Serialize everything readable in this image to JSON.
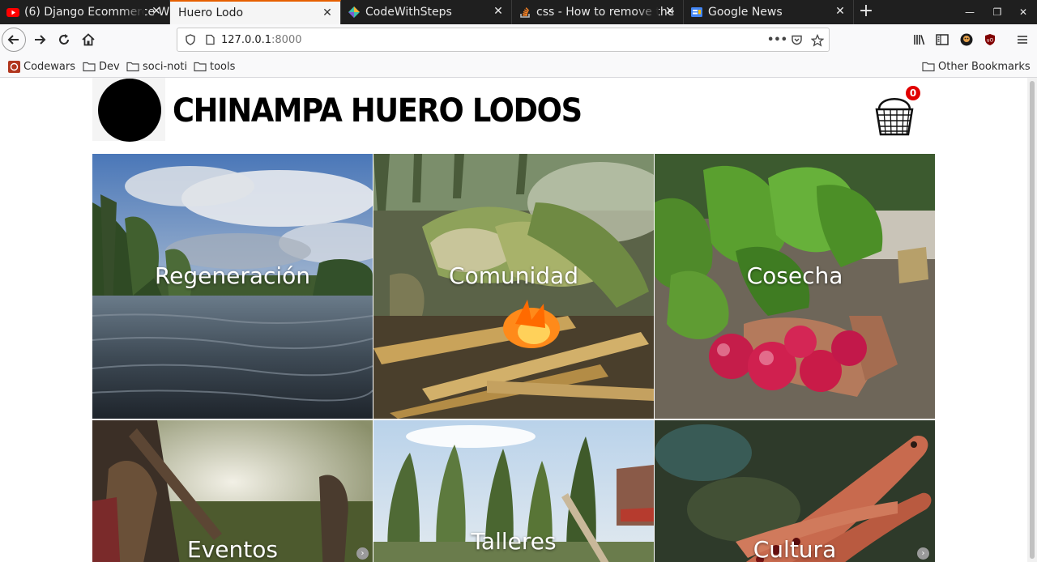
{
  "browser": {
    "tabs": [
      {
        "title": "(6) Django Ecommerce W",
        "icon": "youtube-icon",
        "active": false
      },
      {
        "title": "Huero Lodo",
        "icon": "none",
        "active": true
      },
      {
        "title": "CodeWithSteps",
        "icon": "codewithsteps-icon",
        "active": false
      },
      {
        "title": "css - How to remove the",
        "icon": "stackoverflow-icon",
        "active": false
      },
      {
        "title": "Google News",
        "icon": "google-news-icon",
        "active": false
      }
    ],
    "url_host": "127.0.0.1",
    "url_port": ":8000",
    "bookmarks": [
      "Codewars",
      "Dev",
      "soci-noti",
      "tools"
    ],
    "other_bookmarks": "Other Bookmarks"
  },
  "site": {
    "title": "CHINAMPA HUERO LODOS",
    "cart_count": "0"
  },
  "categories": [
    {
      "label": "Regeneración"
    },
    {
      "label": "Comunidad"
    },
    {
      "label": "Cosecha"
    },
    {
      "label": "Eventos"
    },
    {
      "label": "Talleres"
    },
    {
      "label": "Cultura"
    }
  ]
}
